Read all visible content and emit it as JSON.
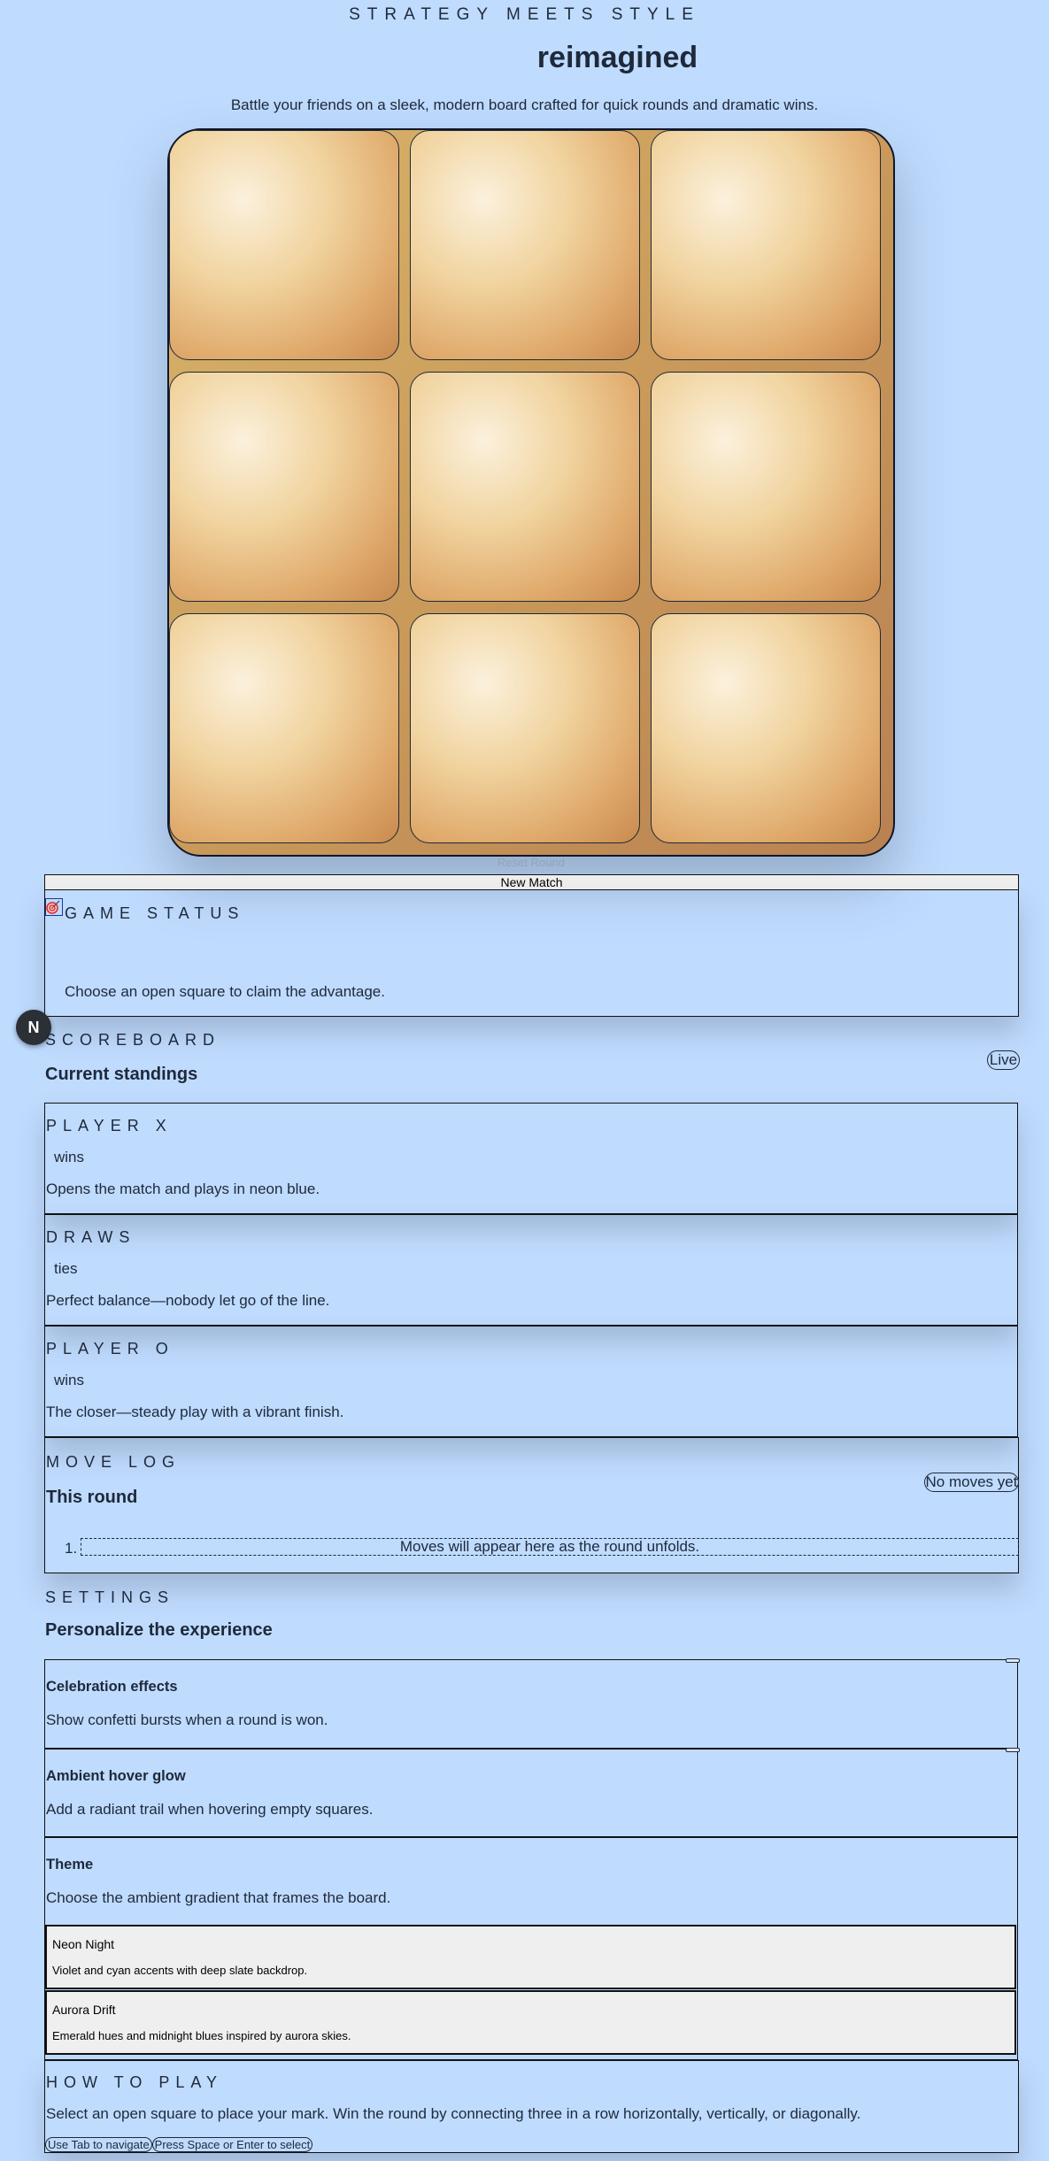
{
  "header": {
    "eyebrow": "STRATEGY MEETS STYLE",
    "title": "reimagined",
    "subtitle": "Battle your friends on a sleek, modern board crafted for quick rounds and dramatic wins."
  },
  "board": {
    "cells": [
      "",
      "",
      "",
      "",
      "",
      "",
      "",
      "",
      ""
    ]
  },
  "controls": {
    "reset_label": "Reset Round",
    "new_match_label": "New Match"
  },
  "status": {
    "eyebrow": "GAME STATUS",
    "message": "Choose an open square to claim the advantage."
  },
  "avatar": {
    "letter": "N"
  },
  "scoreboard": {
    "eyebrow": "SCOREBOARD",
    "title": "Current standings",
    "badge": "Live",
    "cards": [
      {
        "label": "PLAYER X",
        "unit": "wins",
        "description": "Opens the match and plays in neon blue."
      },
      {
        "label": "DRAWS",
        "unit": "ties",
        "description": "Perfect balance—nobody let go of the line."
      },
      {
        "label": "PLAYER O",
        "unit": "wins",
        "description": "The closer—steady play with a vibrant finish."
      }
    ]
  },
  "move_log": {
    "eyebrow": "MOVE LOG",
    "title": "This round",
    "badge": "No moves yet",
    "empty_number": "1.",
    "empty_message": "Moves will appear here as the round unfolds."
  },
  "settings": {
    "eyebrow": "SETTINGS",
    "title": "Personalize the experience",
    "options": [
      {
        "title": "Celebration effects",
        "description": "Show confetti bursts when a round is won."
      },
      {
        "title": "Ambient hover glow",
        "description": "Add a radiant trail when hovering empty squares."
      },
      {
        "title": "Theme",
        "description": "Choose the ambient gradient that frames the board."
      }
    ],
    "themes": [
      {
        "name": "Neon Night",
        "description": "Violet and cyan accents with deep slate backdrop."
      },
      {
        "name": "Aurora Drift",
        "description": "Emerald hues and midnight blues inspired by aurora skies."
      }
    ]
  },
  "how_to_play": {
    "eyebrow": "HOW TO PLAY",
    "text": "Select an open square to place your mark. Win the round by connecting three in a row horizontally, vertically, or diagonally.",
    "hints": [
      "Use Tab to navigate",
      "Press Space or Enter to select"
    ]
  },
  "colors": {
    "background": "#bfdbfe",
    "text": "#1e293b",
    "board_frame": "#c99a5a"
  }
}
